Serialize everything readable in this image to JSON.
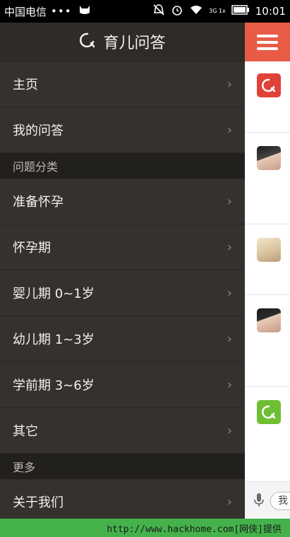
{
  "status_bar": {
    "carrier": "中国电信",
    "dots": "•••",
    "time": "10:01",
    "signal_text": "3G 1x"
  },
  "drawer": {
    "title": "育儿问答",
    "items_top": [
      {
        "label": "主页",
        "chevron": "›"
      },
      {
        "label": "我的问答",
        "chevron": "›"
      }
    ],
    "section_categories": "问题分类",
    "categories": [
      {
        "label": "准备怀孕",
        "chevron": "›"
      },
      {
        "label": "怀孕期",
        "chevron": "›"
      },
      {
        "label": "婴儿期 0~1岁",
        "chevron": "›"
      },
      {
        "label": "幼儿期 1~3岁",
        "chevron": "›"
      },
      {
        "label": "学前期 3~6岁",
        "chevron": "›"
      },
      {
        "label": "其它",
        "chevron": "›"
      }
    ],
    "section_more": "更多",
    "more": [
      {
        "label": "关于我们",
        "chevron": "›"
      }
    ]
  },
  "right_pane": {
    "input_placeholder": "我"
  },
  "footer": {
    "text": "http://www.hackhome.com[网侠]提供"
  },
  "colors": {
    "drawer_bg": "#35312d",
    "accent": "#e85c46",
    "footer_bg": "#45b14b"
  }
}
